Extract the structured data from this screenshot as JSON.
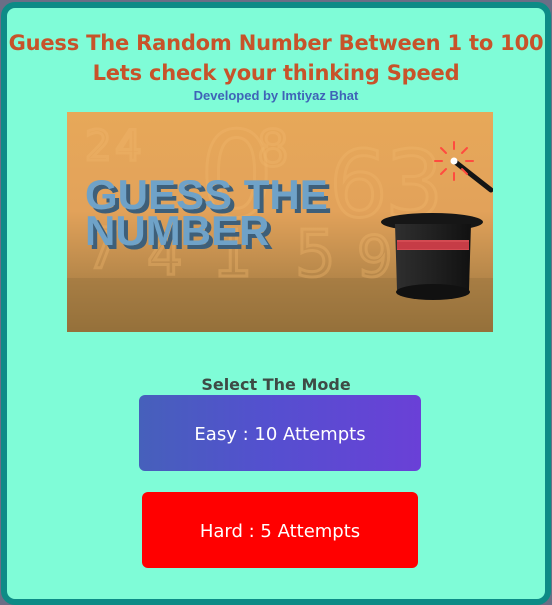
{
  "header": {
    "title": "Guess The Random Number Between 1 to 100",
    "subtitle": "Lets check your thinking Speed",
    "credit": "Developed by Imtiyaz Bhat"
  },
  "banner": {
    "headline_line1": "GUESS THE",
    "headline_line2": "NUMBER",
    "background_digits": [
      "2",
      "4",
      "0",
      "8",
      "6",
      "3",
      "7",
      "4",
      "1",
      "5",
      "9"
    ],
    "colors": {
      "sky": "#e7a859",
      "floor": "#8c6a35",
      "headline": "#6fa2c8",
      "hat": "#1f1f1f",
      "hat_band": "#d34b52"
    },
    "icons": [
      "magic-hat-icon",
      "magic-wand-icon"
    ]
  },
  "mode": {
    "label": "Select The Mode",
    "easy_label": "Easy : 10 Attempts",
    "hard_label": "Hard : 5 Attempts"
  },
  "colors": {
    "page_background": "#7ffcd7",
    "border": "#0d8b86",
    "title": "#c7532a",
    "credit": "#3f63b7",
    "easy_button": "#5450cf",
    "hard_button": "#ff0000"
  }
}
